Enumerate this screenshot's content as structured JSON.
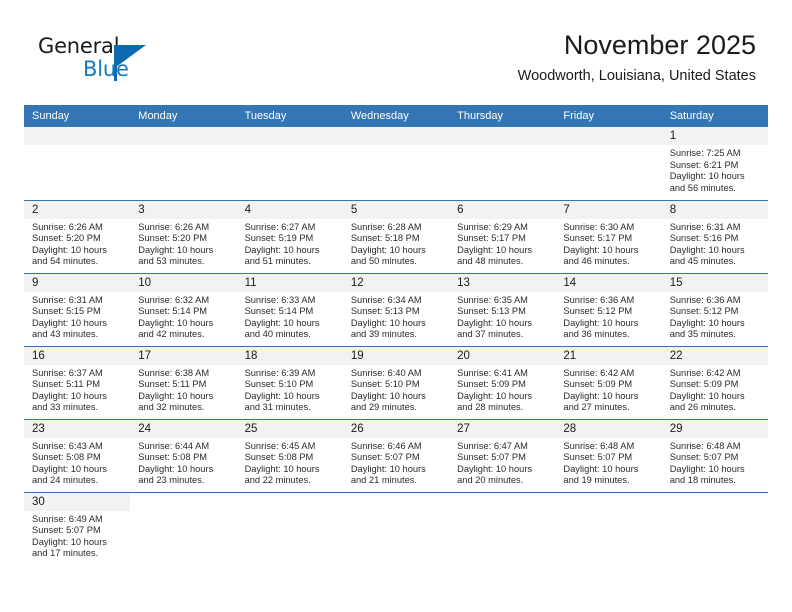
{
  "brand": {
    "name_top": "General",
    "name_bottom": "Blue",
    "triangle_color": "#0d6ab0",
    "blue_text_color": "#1878bd"
  },
  "header": {
    "month_title": "November 2025",
    "location": "Woodworth, Louisiana, United States"
  },
  "theme": {
    "header_row_bg": "#3476b5",
    "header_row_text": "#ffffff",
    "daynum_band_bg": "#f2f2f2",
    "row_divider": "#3476b5",
    "cell_bg": "#ffffff",
    "body_text": "#2b2b2b"
  },
  "weekday_headers": [
    "Sunday",
    "Monday",
    "Tuesday",
    "Wednesday",
    "Thursday",
    "Friday",
    "Saturday"
  ],
  "labels": {
    "sunrise_prefix": "Sunrise:",
    "sunset_prefix": "Sunset:",
    "daylight_prefix": "Daylight:"
  },
  "weeks": [
    [
      {
        "empty": true
      },
      {
        "empty": true
      },
      {
        "empty": true
      },
      {
        "empty": true
      },
      {
        "empty": true
      },
      {
        "empty": true
      },
      {
        "day": "1",
        "sunrise": "Sunrise: 7:25 AM",
        "sunset": "Sunset: 6:21 PM",
        "daylight_line1": "Daylight: 10 hours",
        "daylight_line2": "and 56 minutes."
      }
    ],
    [
      {
        "day": "2",
        "sunrise": "Sunrise: 6:26 AM",
        "sunset": "Sunset: 5:20 PM",
        "daylight_line1": "Daylight: 10 hours",
        "daylight_line2": "and 54 minutes."
      },
      {
        "day": "3",
        "sunrise": "Sunrise: 6:26 AM",
        "sunset": "Sunset: 5:20 PM",
        "daylight_line1": "Daylight: 10 hours",
        "daylight_line2": "and 53 minutes."
      },
      {
        "day": "4",
        "sunrise": "Sunrise: 6:27 AM",
        "sunset": "Sunset: 5:19 PM",
        "daylight_line1": "Daylight: 10 hours",
        "daylight_line2": "and 51 minutes."
      },
      {
        "day": "5",
        "sunrise": "Sunrise: 6:28 AM",
        "sunset": "Sunset: 5:18 PM",
        "daylight_line1": "Daylight: 10 hours",
        "daylight_line2": "and 50 minutes."
      },
      {
        "day": "6",
        "sunrise": "Sunrise: 6:29 AM",
        "sunset": "Sunset: 5:17 PM",
        "daylight_line1": "Daylight: 10 hours",
        "daylight_line2": "and 48 minutes."
      },
      {
        "day": "7",
        "sunrise": "Sunrise: 6:30 AM",
        "sunset": "Sunset: 5:17 PM",
        "daylight_line1": "Daylight: 10 hours",
        "daylight_line2": "and 46 minutes."
      },
      {
        "day": "8",
        "sunrise": "Sunrise: 6:31 AM",
        "sunset": "Sunset: 5:16 PM",
        "daylight_line1": "Daylight: 10 hours",
        "daylight_line2": "and 45 minutes."
      }
    ],
    [
      {
        "day": "9",
        "sunrise": "Sunrise: 6:31 AM",
        "sunset": "Sunset: 5:15 PM",
        "daylight_line1": "Daylight: 10 hours",
        "daylight_line2": "and 43 minutes."
      },
      {
        "day": "10",
        "sunrise": "Sunrise: 6:32 AM",
        "sunset": "Sunset: 5:14 PM",
        "daylight_line1": "Daylight: 10 hours",
        "daylight_line2": "and 42 minutes."
      },
      {
        "day": "11",
        "sunrise": "Sunrise: 6:33 AM",
        "sunset": "Sunset: 5:14 PM",
        "daylight_line1": "Daylight: 10 hours",
        "daylight_line2": "and 40 minutes."
      },
      {
        "day": "12",
        "sunrise": "Sunrise: 6:34 AM",
        "sunset": "Sunset: 5:13 PM",
        "daylight_line1": "Daylight: 10 hours",
        "daylight_line2": "and 39 minutes."
      },
      {
        "day": "13",
        "sunrise": "Sunrise: 6:35 AM",
        "sunset": "Sunset: 5:13 PM",
        "daylight_line1": "Daylight: 10 hours",
        "daylight_line2": "and 37 minutes."
      },
      {
        "day": "14",
        "sunrise": "Sunrise: 6:36 AM",
        "sunset": "Sunset: 5:12 PM",
        "daylight_line1": "Daylight: 10 hours",
        "daylight_line2": "and 36 minutes."
      },
      {
        "day": "15",
        "sunrise": "Sunrise: 6:36 AM",
        "sunset": "Sunset: 5:12 PM",
        "daylight_line1": "Daylight: 10 hours",
        "daylight_line2": "and 35 minutes."
      }
    ],
    [
      {
        "day": "16",
        "sunrise": "Sunrise: 6:37 AM",
        "sunset": "Sunset: 5:11 PM",
        "daylight_line1": "Daylight: 10 hours",
        "daylight_line2": "and 33 minutes."
      },
      {
        "day": "17",
        "sunrise": "Sunrise: 6:38 AM",
        "sunset": "Sunset: 5:11 PM",
        "daylight_line1": "Daylight: 10 hours",
        "daylight_line2": "and 32 minutes."
      },
      {
        "day": "18",
        "sunrise": "Sunrise: 6:39 AM",
        "sunset": "Sunset: 5:10 PM",
        "daylight_line1": "Daylight: 10 hours",
        "daylight_line2": "and 31 minutes."
      },
      {
        "day": "19",
        "sunrise": "Sunrise: 6:40 AM",
        "sunset": "Sunset: 5:10 PM",
        "daylight_line1": "Daylight: 10 hours",
        "daylight_line2": "and 29 minutes."
      },
      {
        "day": "20",
        "sunrise": "Sunrise: 6:41 AM",
        "sunset": "Sunset: 5:09 PM",
        "daylight_line1": "Daylight: 10 hours",
        "daylight_line2": "and 28 minutes."
      },
      {
        "day": "21",
        "sunrise": "Sunrise: 6:42 AM",
        "sunset": "Sunset: 5:09 PM",
        "daylight_line1": "Daylight: 10 hours",
        "daylight_line2": "and 27 minutes."
      },
      {
        "day": "22",
        "sunrise": "Sunrise: 6:42 AM",
        "sunset": "Sunset: 5:09 PM",
        "daylight_line1": "Daylight: 10 hours",
        "daylight_line2": "and 26 minutes."
      }
    ],
    [
      {
        "day": "23",
        "sunrise": "Sunrise: 6:43 AM",
        "sunset": "Sunset: 5:08 PM",
        "daylight_line1": "Daylight: 10 hours",
        "daylight_line2": "and 24 minutes."
      },
      {
        "day": "24",
        "sunrise": "Sunrise: 6:44 AM",
        "sunset": "Sunset: 5:08 PM",
        "daylight_line1": "Daylight: 10 hours",
        "daylight_line2": "and 23 minutes."
      },
      {
        "day": "25",
        "sunrise": "Sunrise: 6:45 AM",
        "sunset": "Sunset: 5:08 PM",
        "daylight_line1": "Daylight: 10 hours",
        "daylight_line2": "and 22 minutes."
      },
      {
        "day": "26",
        "sunrise": "Sunrise: 6:46 AM",
        "sunset": "Sunset: 5:07 PM",
        "daylight_line1": "Daylight: 10 hours",
        "daylight_line2": "and 21 minutes."
      },
      {
        "day": "27",
        "sunrise": "Sunrise: 6:47 AM",
        "sunset": "Sunset: 5:07 PM",
        "daylight_line1": "Daylight: 10 hours",
        "daylight_line2": "and 20 minutes."
      },
      {
        "day": "28",
        "sunrise": "Sunrise: 6:48 AM",
        "sunset": "Sunset: 5:07 PM",
        "daylight_line1": "Daylight: 10 hours",
        "daylight_line2": "and 19 minutes."
      },
      {
        "day": "29",
        "sunrise": "Sunrise: 6:48 AM",
        "sunset": "Sunset: 5:07 PM",
        "daylight_line1": "Daylight: 10 hours",
        "daylight_line2": "and 18 minutes."
      }
    ],
    [
      {
        "day": "30",
        "sunrise": "Sunrise: 6:49 AM",
        "sunset": "Sunset: 5:07 PM",
        "daylight_line1": "Daylight: 10 hours",
        "daylight_line2": "and 17 minutes."
      },
      {
        "blank": true
      },
      {
        "blank": true
      },
      {
        "blank": true
      },
      {
        "blank": true
      },
      {
        "blank": true
      },
      {
        "blank": true
      }
    ]
  ]
}
